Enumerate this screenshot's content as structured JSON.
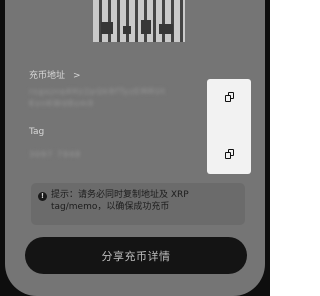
{
  "address": {
    "label": "充币地址",
    "chevron": ">",
    "value_line1": "rsgxjnq4Hz2pQk8fTyzEMRUt",
    "value_line2": "KvnKWd8sm9"
  },
  "tag": {
    "label": "Tag",
    "value": "3097 7948"
  },
  "notice": {
    "icon": "info-icon",
    "text": "提示：请务必同时复制地址及 XRP tag/memo，以确保成功充币"
  },
  "share_button": {
    "label": "分享充币详情"
  },
  "icons": {
    "copy_address": "copy-icon",
    "copy_tag": "copy-icon"
  }
}
